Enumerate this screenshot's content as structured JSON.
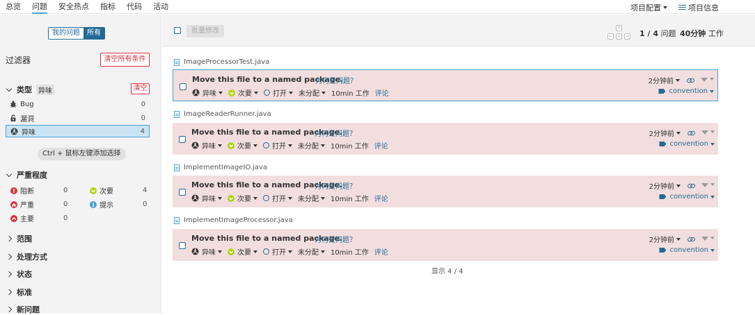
{
  "nav": {
    "tabs": [
      "总览",
      "问题",
      "安全热点",
      "指标",
      "代码",
      "活动"
    ],
    "active_tab": 1,
    "project_settings": "项目配置",
    "project_info": "项目信息"
  },
  "sidebar": {
    "toggle": {
      "mine": "我的问题",
      "all": "所有"
    },
    "filters_title": "过滤器",
    "clear_all": "清空所有条件",
    "type_facet": {
      "title": "类型",
      "badge": "异味",
      "clear": "清空",
      "items": [
        {
          "label": "Bug",
          "count": "0",
          "icon": "bug-icon"
        },
        {
          "label": "漏洞",
          "count": "0",
          "icon": "lock-icon"
        },
        {
          "label": "异味",
          "count": "4",
          "icon": "code-smell-icon",
          "selected": true
        }
      ]
    },
    "hint": "Ctrl + 鼠标左键添加选择",
    "severity": {
      "title": "严重程度",
      "items": [
        {
          "label": "阻断",
          "count": "0",
          "color": "#d4333f",
          "icon": "blocker-icon"
        },
        {
          "label": "次要",
          "count": "4",
          "color": "#b0d513",
          "icon": "minor-icon"
        },
        {
          "label": "严重",
          "count": "0",
          "color": "#d4333f",
          "icon": "critical-icon"
        },
        {
          "label": "提示",
          "count": "0",
          "color": "#4b9fd5",
          "icon": "info-icon"
        },
        {
          "label": "主要",
          "count": "0",
          "color": "#d4333f",
          "icon": "major-icon"
        }
      ]
    },
    "collapsed_facets": [
      "范围",
      "处理方式",
      "状态",
      "标准",
      "新问题"
    ]
  },
  "toolbar": {
    "bulk_change": "批量修改",
    "page_count": "1 / 4",
    "issues_label": "问题",
    "effort_value": "40分钟",
    "effort_label": "工作"
  },
  "issues": [
    {
      "file": "ImageProcessorTest.java",
      "message": "Move this file to a named package.",
      "why": "为何是问题？",
      "type": "异味",
      "severity": "次要",
      "status": "打开",
      "assignee": "未分配",
      "effort": "10min 工作",
      "comment": "评论",
      "time": "2分钟前",
      "tag": "convention"
    },
    {
      "file": "ImageReaderRunner.java",
      "message": "Move this file to a named package.",
      "why": "为何是问题？",
      "type": "异味",
      "severity": "次要",
      "status": "打开",
      "assignee": "未分配",
      "effort": "10min 工作",
      "comment": "评论",
      "time": "2分钟前",
      "tag": "convention"
    },
    {
      "file": "ImplementImageIO.java",
      "message": "Move this file to a named package.",
      "why": "为何是问题？",
      "type": "异味",
      "severity": "次要",
      "status": "打开",
      "assignee": "未分配",
      "effort": "10min 工作",
      "comment": "评论",
      "time": "2分钟前",
      "tag": "convention"
    },
    {
      "file": "ImplementImageProcessor.java",
      "message": "Move this file to a named package.",
      "why": "为何是问题？",
      "type": "异味",
      "severity": "次要",
      "status": "打开",
      "assignee": "未分配",
      "effort": "10min 工作",
      "comment": "评论",
      "time": "2分钟前",
      "tag": "convention"
    }
  ],
  "shown": "显示 4 / 4",
  "colors": {
    "accent": "#236a97",
    "highlight": "#4b9fd5",
    "issue_bg": "#f2dede",
    "danger": "#d4333f"
  }
}
